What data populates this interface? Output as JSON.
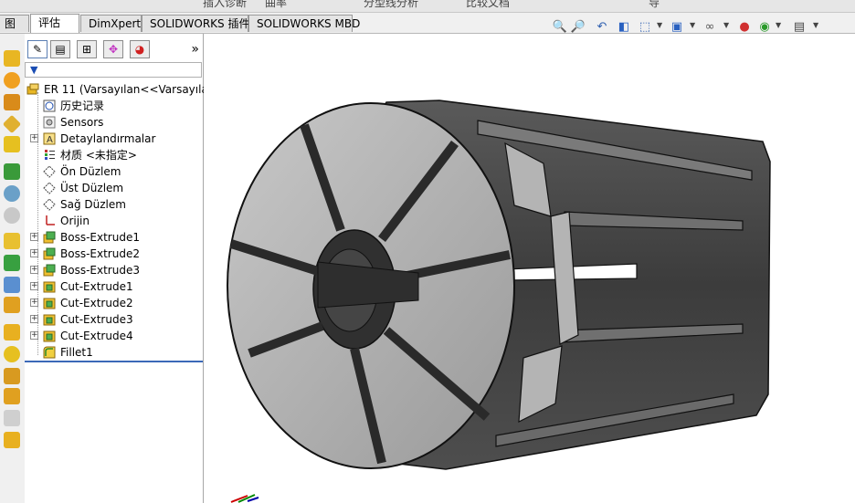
{
  "top_strip": {
    "items": [
      "插入诊断",
      "曲率",
      "分型线分析",
      "比较文档",
      "导"
    ]
  },
  "command_tabs": [
    {
      "label": "图",
      "active": false
    },
    {
      "label": "评估",
      "active": true
    },
    {
      "label": "DimXpert",
      "active": false
    },
    {
      "label": "SOLIDWORKS 插件",
      "active": false
    },
    {
      "label": "SOLIDWORKS MBD",
      "active": false
    }
  ],
  "panel_tabs": [
    {
      "icon": "feature-manager-icon",
      "glyph": "✎"
    },
    {
      "icon": "property-manager-icon",
      "glyph": "▤"
    },
    {
      "icon": "configuration-manager-icon",
      "glyph": "⊞"
    },
    {
      "icon": "dimxpert-manager-icon",
      "glyph": "✥"
    },
    {
      "icon": "display-manager-icon",
      "glyph": "◕"
    }
  ],
  "panel_more": "»",
  "filter_icon": "funnel-icon",
  "tree": {
    "root": "ER 11  (Varsayılan<<Varsayılan",
    "items": [
      {
        "label": "历史记录",
        "icon": "history-icon",
        "expand": false
      },
      {
        "label": "Sensors",
        "icon": "sensor-icon",
        "expand": false
      },
      {
        "label": "Detaylandırmalar",
        "icon": "annotation-icon",
        "expand": true
      },
      {
        "label": "材质 <未指定>",
        "icon": "material-icon",
        "expand": false
      },
      {
        "label": "Ön Düzlem",
        "icon": "plane-icon",
        "expand": false
      },
      {
        "label": "Üst Düzlem",
        "icon": "plane-icon",
        "expand": false
      },
      {
        "label": "Sağ Düzlem",
        "icon": "plane-icon",
        "expand": false
      },
      {
        "label": "Orijin",
        "icon": "origin-icon",
        "expand": false
      },
      {
        "label": "Boss-Extrude1",
        "icon": "boss-extrude-icon",
        "expand": true
      },
      {
        "label": "Boss-Extrude2",
        "icon": "boss-extrude-icon",
        "expand": true
      },
      {
        "label": "Boss-Extrude3",
        "icon": "boss-extrude-icon",
        "expand": true
      },
      {
        "label": "Cut-Extrude1",
        "icon": "cut-extrude-icon",
        "expand": true
      },
      {
        "label": "Cut-Extrude2",
        "icon": "cut-extrude-icon",
        "expand": true
      },
      {
        "label": "Cut-Extrude3",
        "icon": "cut-extrude-icon",
        "expand": true
      },
      {
        "label": "Cut-Extrude4",
        "icon": "cut-extrude-icon",
        "expand": true
      },
      {
        "label": "Fillet1",
        "icon": "fillet-icon",
        "expand": false
      }
    ]
  },
  "hud_icons": [
    "zoom-to-fit-icon",
    "zoom-area-icon",
    "previous-view-icon",
    "section-view-icon",
    "view-orientation-icon",
    "display-style-icon",
    "hide-show-icon",
    "edit-appearance-icon",
    "apply-scene-icon",
    "view-settings-icon"
  ],
  "colors": {
    "accent": "#3b68b8",
    "part_light": "#b4b4b4",
    "part_dark": "#4a4a4a",
    "edge": "#111111"
  }
}
